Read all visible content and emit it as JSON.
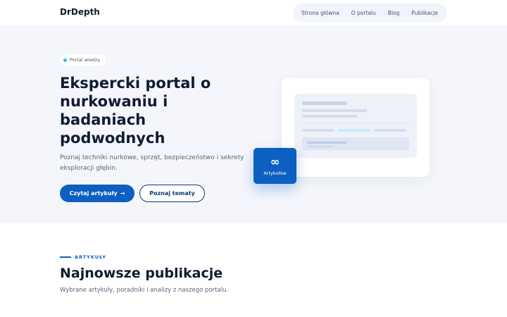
{
  "header": {
    "logo": "DrDepth",
    "nav": [
      "Strona główna",
      "O portalu",
      "Blog",
      "Publikacje"
    ]
  },
  "hero": {
    "badge": "Portal wiedzy",
    "title": "Ekspercki portal o nurkowaniu i badaniach podwodnych",
    "subtitle": "Poznaj techniki nurkowe, sprzęt, bezpieczeństwo i sekrety eksploracji głębin.",
    "primary_button": "Czytaj artykuły",
    "primary_button_arrow": "→",
    "secondary_button": "Poznaj tematy",
    "stat_value": "∞",
    "stat_label": "Artykułów"
  },
  "section": {
    "eyebrow": "ARTYKUŁY",
    "title": "Najnowsze publikacje",
    "subtitle": "Wybrane artykuły, poradniki i analizy z naszego portalu."
  },
  "colors": {
    "primary": "#0d5fc2",
    "dark_text": "#0f1b33",
    "hero_bg": "#f4f6fb",
    "accent_dot": "#22c3e6"
  }
}
